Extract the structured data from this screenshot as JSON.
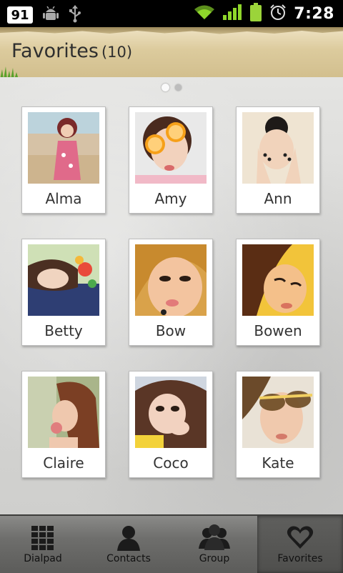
{
  "status_bar": {
    "badge": "91",
    "time": "7:28",
    "icons": [
      "notification-count-icon",
      "android-debug-icon",
      "usb-icon",
      "wifi-icon",
      "signal-icon",
      "battery-icon",
      "alarm-icon"
    ]
  },
  "header": {
    "title": "Favorites",
    "count": "(10)"
  },
  "pager": {
    "pages": 2,
    "current": 1
  },
  "favorites": [
    {
      "name": "Alma"
    },
    {
      "name": "Amy"
    },
    {
      "name": "Ann"
    },
    {
      "name": "Betty"
    },
    {
      "name": "Bow"
    },
    {
      "name": "Bowen"
    },
    {
      "name": "Claire"
    },
    {
      "name": "Coco"
    },
    {
      "name": "Kate"
    }
  ],
  "tabs": [
    {
      "label": "Dialpad",
      "icon": "dialpad-icon",
      "selected": false
    },
    {
      "label": "Contacts",
      "icon": "contact-person-icon",
      "selected": false
    },
    {
      "label": "Group",
      "icon": "group-icon",
      "selected": false
    },
    {
      "label": "Favorites",
      "icon": "heart-icon",
      "selected": true
    }
  ],
  "colors": {
    "header_paper": "#dccb9d",
    "tab_bar": "#6e6e6c",
    "wifi_green": "#8fd62b",
    "battery_green": "#9bd43a"
  }
}
